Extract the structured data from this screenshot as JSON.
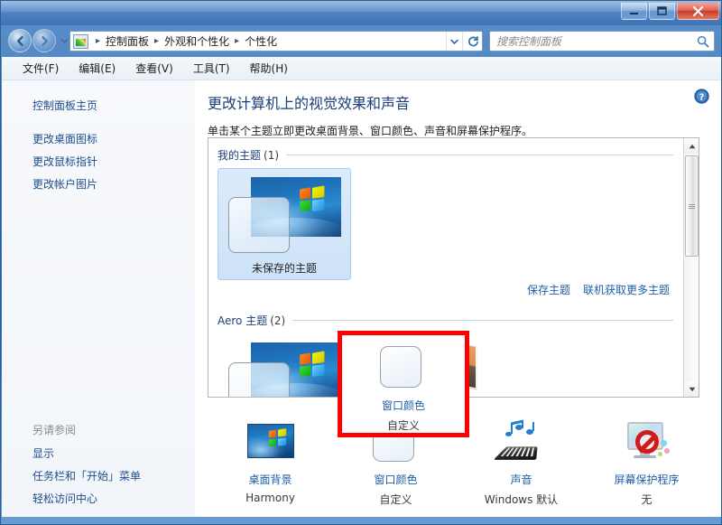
{
  "window": {
    "caption_buttons": [
      {
        "name": "minimize",
        "glyph": "minimize-icon"
      },
      {
        "name": "maximize",
        "glyph": "maximize-icon"
      },
      {
        "name": "close",
        "glyph": "close-icon"
      }
    ]
  },
  "addressbar": {
    "back_label": "后退",
    "forward_label": "前进",
    "breadcrumbs": [
      "控制面板",
      "外观和个性化",
      "个性化"
    ],
    "separator": "▸"
  },
  "search": {
    "placeholder": "搜索控制面板",
    "value": ""
  },
  "menubar": {
    "items": [
      "文件(F)",
      "编辑(E)",
      "查看(V)",
      "工具(T)",
      "帮助(H)"
    ]
  },
  "sidebar": {
    "home_link": "控制面板主页",
    "links": [
      "更改桌面图标",
      "更改鼠标指针",
      "更改帐户图片"
    ],
    "see_also_heading": "另请参阅",
    "see_also_links": [
      "显示",
      "任务栏和「开始」菜单",
      "轻松访问中心"
    ]
  },
  "content": {
    "title": "更改计算机上的视觉效果和声音",
    "subtitle": "单击某个主题立即更改桌面背景、窗口颜色、声音和屏幕保护程序。",
    "groups": [
      {
        "name": "我的主题",
        "count": "(1)",
        "themes": [
          {
            "label": "未保存的主题",
            "selected": true
          }
        ]
      },
      {
        "name": "Aero 主题",
        "count": "(2)",
        "themes": [
          {
            "label": "",
            "selected": false
          },
          {
            "label": "",
            "selected": false
          }
        ]
      }
    ],
    "theme_links": [
      "保存主题",
      "联机获取更多主题"
    ]
  },
  "settings": [
    {
      "label": "桌面背景",
      "value": "Harmony",
      "icon": "wallpaper-icon",
      "highlighted": false
    },
    {
      "label": "窗口颜色",
      "value": "自定义",
      "icon": "window-color-icon",
      "highlighted": true
    },
    {
      "label": "声音",
      "value": "Windows 默认",
      "icon": "sound-icon",
      "highlighted": false
    },
    {
      "label": "屏幕保护程序",
      "value": "无",
      "icon": "screensaver-icon",
      "highlighted": false
    }
  ],
  "colors": {
    "link": "#1f5fa8",
    "title": "#1a3f7a",
    "highlight": "#ff0000",
    "titlebar": "#4b81c2"
  }
}
